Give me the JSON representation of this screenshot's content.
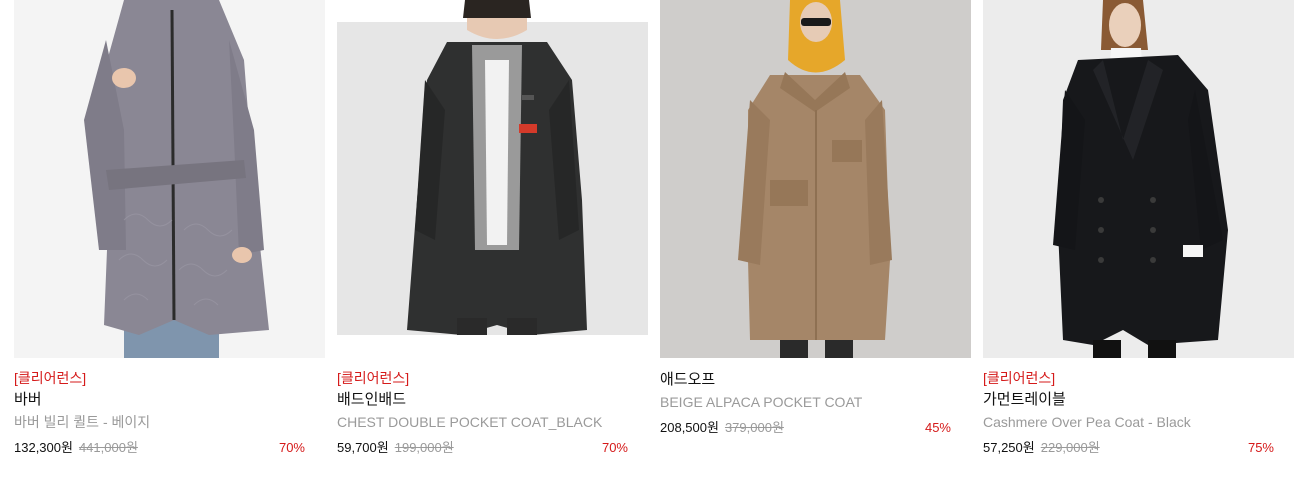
{
  "products": [
    {
      "tag": "[클리어런스]",
      "brand": "바버",
      "name": "바버 빌리 퀼트 - 베이지",
      "price": "132,300원",
      "original_price": "441,000원",
      "discount": "70%",
      "image": "quilted-coat-gray"
    },
    {
      "tag": "[클리어런스]",
      "brand": "배드인배드",
      "name": "CHEST DOUBLE POCKET COAT_BLACK",
      "price": "59,700원",
      "original_price": "199,000원",
      "discount": "70%",
      "image": "black-long-coat"
    },
    {
      "tag": "",
      "brand": "애드오프",
      "name": "BEIGE ALPACA POCKET COAT",
      "price": "208,500원",
      "original_price": "379,000원",
      "discount": "45%",
      "image": "beige-alpaca-coat"
    },
    {
      "tag": "[클리어런스]",
      "brand": "가먼트레이블",
      "name": "Cashmere Over Pea Coat - Black",
      "price": "57,250원",
      "original_price": "229,000원",
      "discount": "75%",
      "image": "black-pea-coat"
    }
  ],
  "colors": {
    "accent_red": "#d51a1a",
    "muted_gray": "#9a9a9a"
  }
}
